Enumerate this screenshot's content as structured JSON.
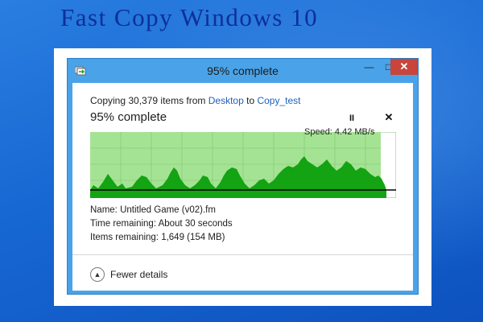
{
  "banner": {
    "title": "Fast Copy Windows 10"
  },
  "window": {
    "title": "95% complete",
    "icon": "file-copy-icon",
    "controls": {
      "minimize": "—",
      "maximize": "□",
      "close": "✕"
    }
  },
  "copy": {
    "prefix": "Copying 30,379 items from ",
    "source": "Desktop",
    "middle": " to ",
    "destination": "Copy_test",
    "percent_text": "95% complete",
    "progress": 0.95,
    "pause_glyph": "II",
    "stop_glyph": "✕"
  },
  "graph": {
    "speed_label": "Speed: 4.42 MB/s",
    "colors": {
      "fill": "#a5e394",
      "area": "#13a313",
      "grid": "#78c868",
      "line": "#000000"
    }
  },
  "details": {
    "name": "Name:  Untitled Game (v02).fm",
    "time_remaining": "Time remaining:  About 30 seconds",
    "items_remaining": "Items remaining:  1,649 (154 MB)"
  },
  "footer": {
    "fewer_details": "Fewer details",
    "chevron": "▲"
  }
}
